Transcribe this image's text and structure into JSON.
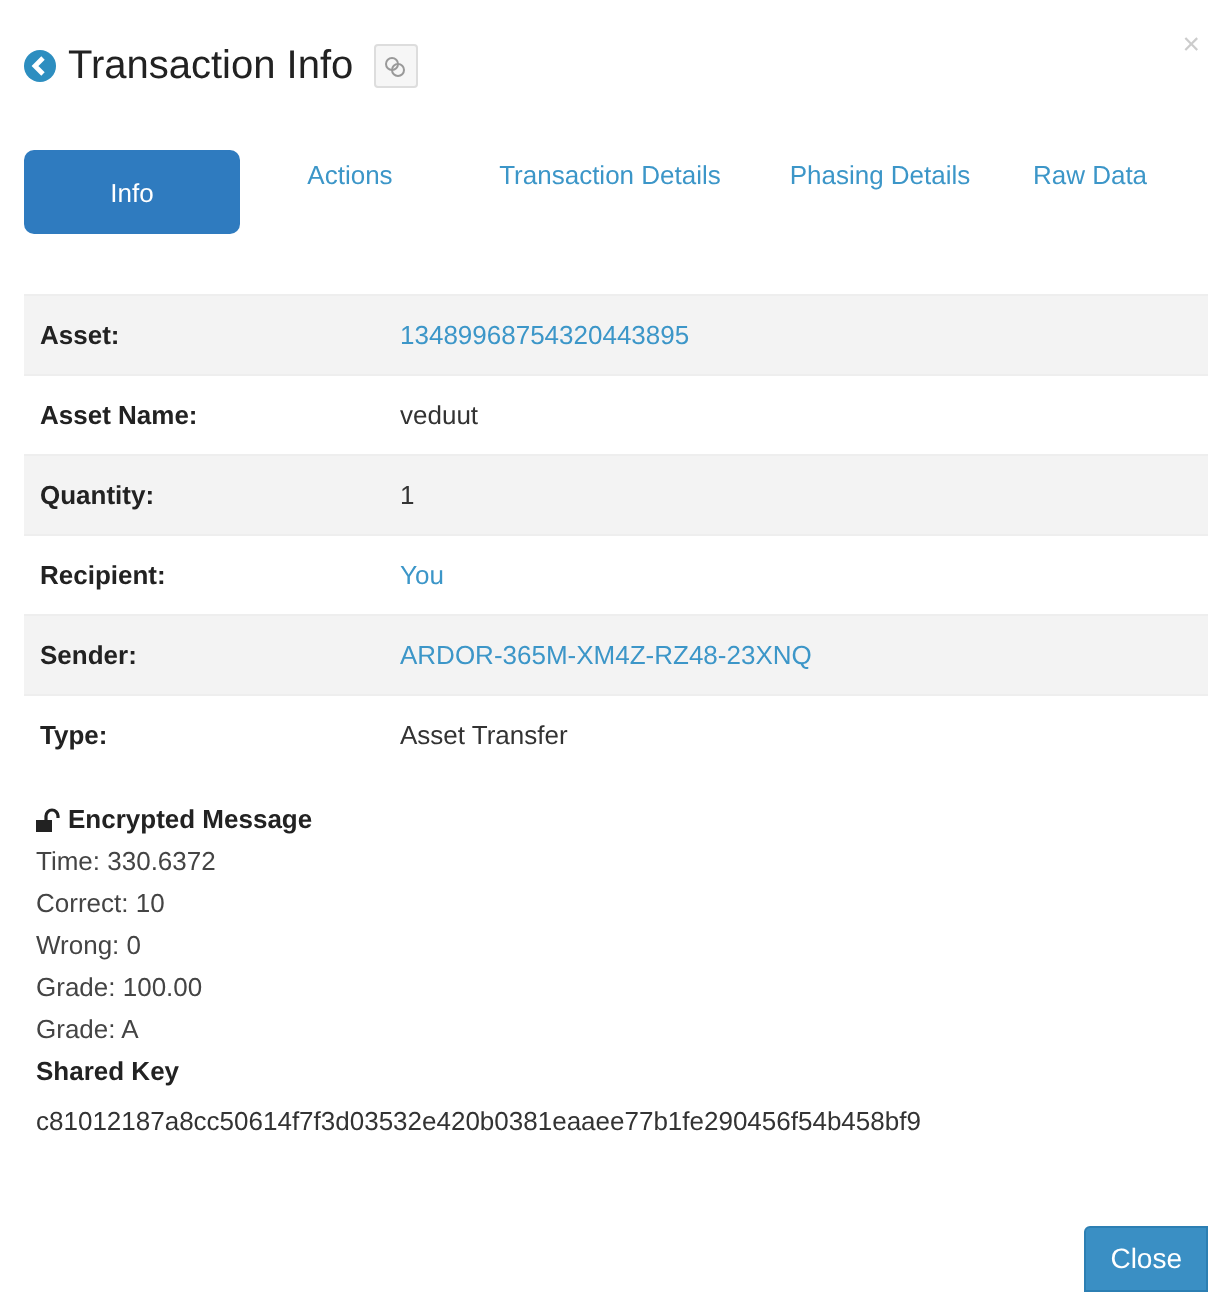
{
  "dialog": {
    "title": "Transaction Info",
    "close_glyph": "×"
  },
  "tabs": [
    {
      "label": "Info",
      "selected": true
    },
    {
      "label": "Actions",
      "selected": false
    },
    {
      "label": "Transaction Details",
      "selected": false
    },
    {
      "label": "Phasing Details",
      "selected": false
    },
    {
      "label": "Raw Data",
      "selected": false
    }
  ],
  "details": [
    {
      "label": "Asset:",
      "value": "13489968754320443895",
      "kind": "link"
    },
    {
      "label": "Asset Name:",
      "value": "veduut",
      "kind": "text"
    },
    {
      "label": "Quantity:",
      "value": "1",
      "kind": "text"
    },
    {
      "label": "Recipient:",
      "value": "You",
      "kind": "link"
    },
    {
      "label": "Sender:",
      "value": "ARDOR-365M-XM4Z-RZ48-23XNQ",
      "kind": "link"
    },
    {
      "label": "Type:",
      "value": "Asset Transfer",
      "kind": "text"
    }
  ],
  "message": {
    "title": "Encrypted Message",
    "lines": [
      "Time: 330.6372",
      "Correct: 10",
      "Wrong: 0",
      "Grade: 100.00",
      "Grade: A"
    ],
    "key_title": "Shared Key",
    "key": "c81012187a8cc50614f7f3d03532e420b0381eaaee77b1fe290456f54b458bf9"
  },
  "buttons": [
    {
      "label": "Close"
    }
  ]
}
